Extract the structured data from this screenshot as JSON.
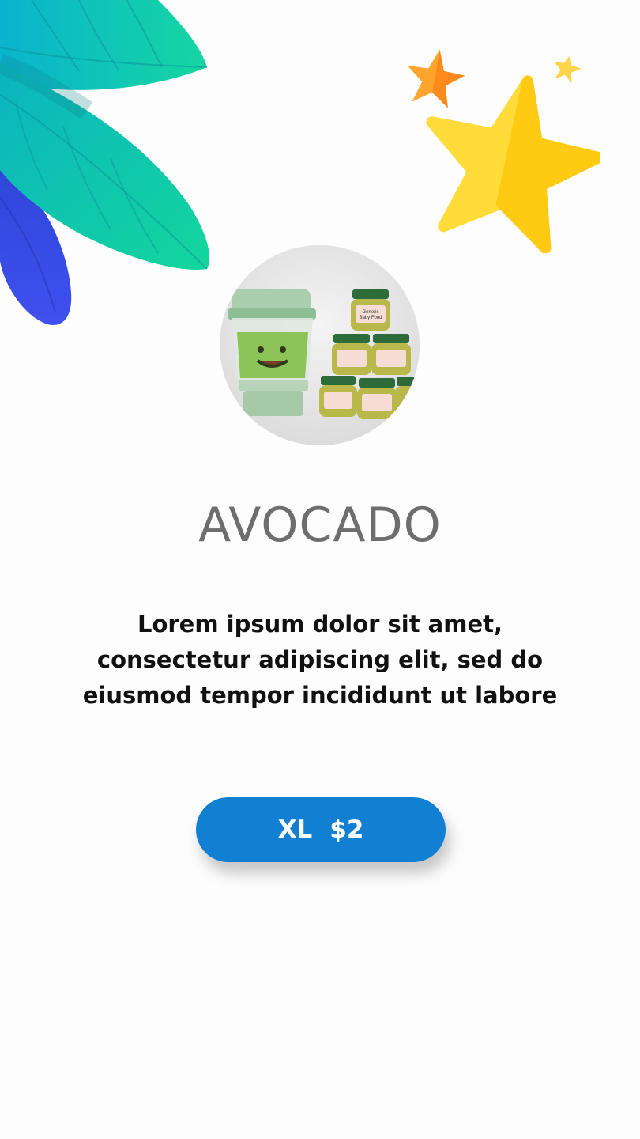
{
  "product": {
    "name": "AVOCADO",
    "description_lines": [
      "Lorem ipsum dolor sit amet,",
      "consectetur adipiscing elit, sed do",
      "eiusmod tempor incididunt ut labore"
    ],
    "image_icon": "baby-food-jars-photo",
    "jar_labels": [
      "Generic",
      "Baby Food"
    ]
  },
  "price_button": {
    "size": "XL",
    "price": "$2"
  },
  "decorations": {
    "leaves_icon": "leaves-icon",
    "stars_icon": "stars-icon"
  },
  "colors": {
    "accent": "#1180d2",
    "title": "#6e6e6e",
    "star_yellow": "#ffd02a",
    "star_orange": "#ff9a2a",
    "leaf_teal": "#10c8a8",
    "leaf_blue": "#3a48e8"
  }
}
